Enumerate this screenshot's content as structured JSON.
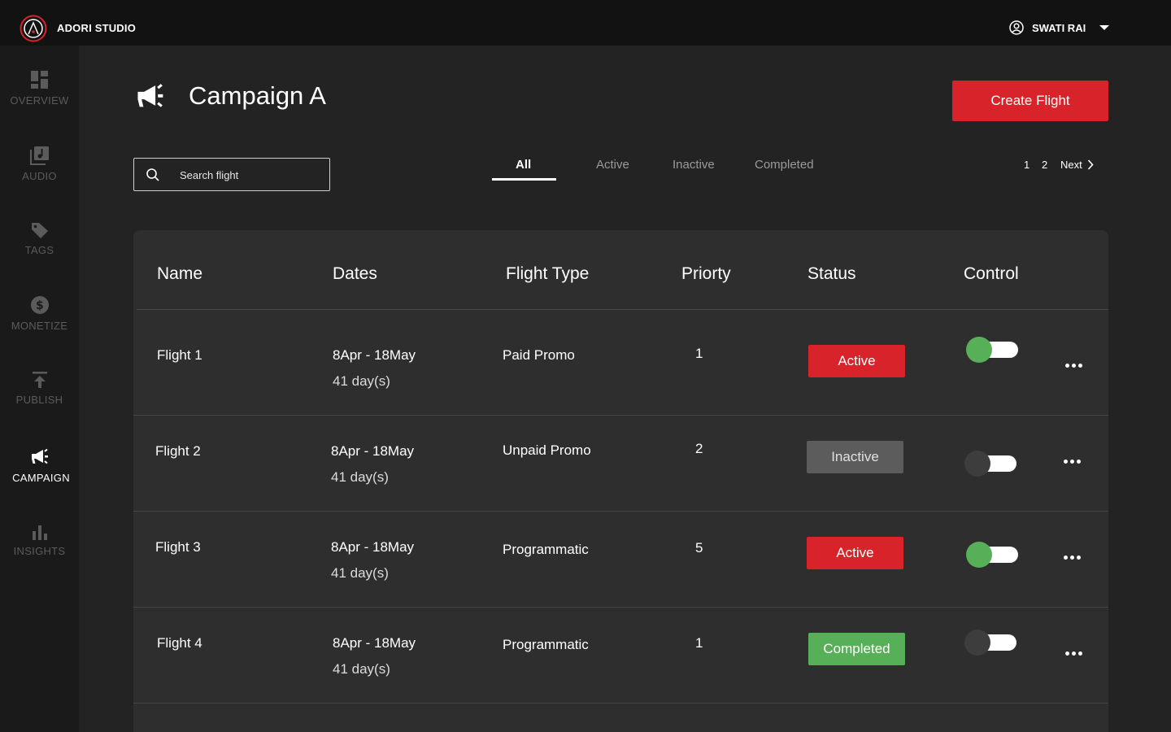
{
  "app": {
    "brand": "ADORI STUDIO"
  },
  "user": {
    "name": "SWATI RAI"
  },
  "sidebar": {
    "items": [
      {
        "label": "OVERVIEW",
        "icon": "dashboard-icon"
      },
      {
        "label": "AUDIO",
        "icon": "audio-library-icon"
      },
      {
        "label": "TAGS",
        "icon": "tag-icon"
      },
      {
        "label": "MONETIZE",
        "icon": "dollar-icon"
      },
      {
        "label": "PUBLISH",
        "icon": "publish-icon"
      },
      {
        "label": "CAMPAIGN",
        "icon": "megaphone-icon",
        "active": true
      },
      {
        "label": "INSIGHTS",
        "icon": "bar-chart-icon"
      }
    ]
  },
  "page": {
    "title": "Campaign A",
    "create_label": "Create Flight"
  },
  "search": {
    "placeholder": "Search flight",
    "value": ""
  },
  "tabs": [
    {
      "label": "All",
      "active": true
    },
    {
      "label": "Active"
    },
    {
      "label": "Inactive"
    },
    {
      "label": "Completed"
    }
  ],
  "pagination": {
    "pages": [
      "1",
      "2"
    ],
    "next_label": "Next"
  },
  "table": {
    "headers": [
      "Name",
      "Dates",
      "Flight Type",
      "Priorty",
      "Status",
      "Control"
    ],
    "rows": [
      {
        "name": "Flight 1",
        "dates": "8Apr - 18May",
        "duration": "41 day(s)",
        "type": "Paid Promo",
        "priority": "1",
        "status": "Active",
        "enabled": true
      },
      {
        "name": "Flight 2",
        "dates": "8Apr - 18May",
        "duration": "41 day(s)",
        "type": "Unpaid Promo",
        "priority": "2",
        "status": "Inactive",
        "enabled": false
      },
      {
        "name": "Flight 3",
        "dates": "8Apr - 18May",
        "duration": "41 day(s)",
        "type": "Programmatic",
        "priority": "5",
        "status": "Active",
        "enabled": true
      },
      {
        "name": "Flight 4",
        "dates": "8Apr - 18May",
        "duration": "41 day(s)",
        "type": "Programmatic",
        "priority": "1",
        "status": "Completed",
        "enabled": false
      }
    ]
  },
  "colors": {
    "accent": "#d8232a",
    "success": "#57b058",
    "inactive": "#5c5c5c"
  }
}
